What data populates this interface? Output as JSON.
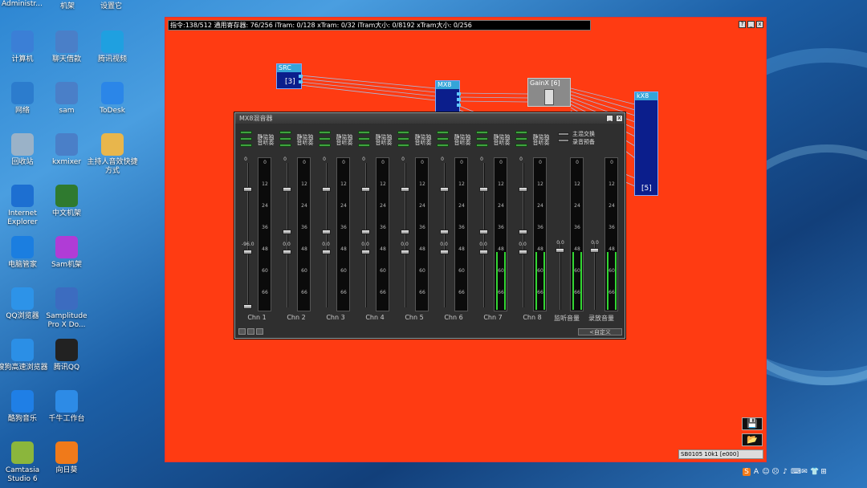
{
  "desktop": {
    "top_labels": [
      "Administr...",
      "机架",
      "设置它"
    ],
    "icons": [
      {
        "label": "计算机",
        "icon": "computer-icon",
        "color": "#3b7fd6"
      },
      {
        "label": "聊天借款",
        "icon": "kx-icon",
        "color": "#4a7fc8"
      },
      {
        "label": "腾讯视频",
        "icon": "video-icon",
        "color": "#1fa0e0"
      },
      {
        "label": "网络",
        "icon": "network-icon",
        "color": "#2c7ccd"
      },
      {
        "label": "sam",
        "icon": "kx-icon",
        "color": "#4a7fc8"
      },
      {
        "label": "ToDesk",
        "icon": "todesk-icon",
        "color": "#2b86e8"
      },
      {
        "label": "回收站",
        "icon": "recycle-bin-icon",
        "color": "#9ab2c8"
      },
      {
        "label": "kxmixer",
        "icon": "kx-icon",
        "color": "#4a7fc8"
      },
      {
        "label": "主持人音效快捷方式",
        "icon": "mascot-icon",
        "color": "#e8b64c"
      },
      {
        "label": "Internet Explorer",
        "icon": "ie-icon",
        "color": "#1d6fd1"
      },
      {
        "label": "中文机架",
        "icon": "rack-icon",
        "color": "#2f7a2f"
      },
      {
        "label": "电脑管家",
        "icon": "shield-icon",
        "color": "#1b7ee0"
      },
      {
        "label": "Sam机架",
        "icon": "rack-icon",
        "color": "#b03cd6"
      },
      {
        "label": "QQ浏览器",
        "icon": "browser-icon",
        "color": "#2d93e8"
      },
      {
        "label": "Samplitude Pro X Do...",
        "icon": "samplitude-icon",
        "color": "#3c6cc0"
      },
      {
        "label": "搜狗高速浏览器",
        "icon": "sogou-browser-icon",
        "color": "#2b8fe6"
      },
      {
        "label": "腾讯QQ",
        "icon": "qq-icon",
        "color": "#222"
      },
      {
        "label": "酷狗音乐",
        "icon": "kugou-icon",
        "color": "#1f7fe6"
      },
      {
        "label": "千牛工作台",
        "icon": "qianniu-icon",
        "color": "#2d8be6"
      },
      {
        "label": "Camtasia Studio 6",
        "icon": "camtasia-icon",
        "color": "#8bb63c"
      },
      {
        "label": "向日葵",
        "icon": "sunflower-icon",
        "color": "#f07a1a"
      }
    ]
  },
  "dsp_window": {
    "title": "指令:138/512 通用寄存器: 76/256 iTram: 0/128 xTram: 0/32 iTram大小: 0/8192 xTram大小: 0/256",
    "nodes": {
      "src": {
        "title": "SRC",
        "value": "[3]"
      },
      "mx8": {
        "title": "MX8"
      },
      "gainx": {
        "title": "GainX [6]"
      },
      "kx8": {
        "title": "kX8",
        "value": "[5]"
      }
    },
    "status": "SB0105 10k1 [e000]",
    "save_icon": "💾",
    "open_icon": "📂"
  },
  "mixer": {
    "title": "MX8混音器",
    "channel_buttons": [
      "静音",
      "监听",
      "独奏"
    ],
    "master_buttons": [
      "主混交换",
      "录音预备"
    ],
    "scale": [
      "0",
      "12",
      "24",
      "36",
      "48",
      "60",
      "66"
    ],
    "channel_levels": [
      "0.0",
      "0.0",
      "0.0",
      "0.0",
      "0.0",
      "0.0",
      "0.0",
      "0.0"
    ],
    "first_channel_level": "-96.0",
    "master_levels": [
      "0.0",
      "0.0"
    ],
    "channels": [
      "Chn 1",
      "Chn 2",
      "Chn 3",
      "Chn 4",
      "Chn 5",
      "Chn 6",
      "Chn 7",
      "Chn 8"
    ],
    "master_labels": [
      "监听音量",
      "录放音量"
    ],
    "bottom_button": "<自定义",
    "active_meters": [
      7,
      8,
      9
    ]
  },
  "tray": {
    "icons": [
      "S",
      "A",
      "☺",
      "☹",
      "♪",
      "⌨",
      "✉",
      "👕",
      "⊞"
    ]
  }
}
